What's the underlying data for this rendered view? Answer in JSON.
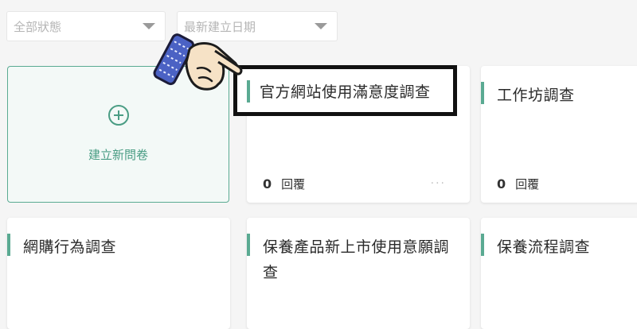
{
  "filters": {
    "status_placeholder": "全部狀態",
    "date_placeholder": "最新建立日期"
  },
  "create_card": {
    "label": "建立新問卷"
  },
  "surveys": [
    {
      "title": "官方網站使用滿意度調查",
      "responses": "0",
      "responses_label": "回覆",
      "more": "···"
    },
    {
      "title": "工作坊調查",
      "responses": "0",
      "responses_label": "回覆"
    },
    {
      "title": "網購行為調查"
    },
    {
      "title": "保養產品新上市使用意願調查"
    },
    {
      "title": "保養流程調查"
    }
  ],
  "colors": {
    "accent": "#5aaa92",
    "create_bg": "#f3f9f7"
  },
  "icons": {
    "plus": "plus-circle-icon",
    "caret": "caret-down-icon",
    "pointer": "pointing-hand-icon"
  }
}
